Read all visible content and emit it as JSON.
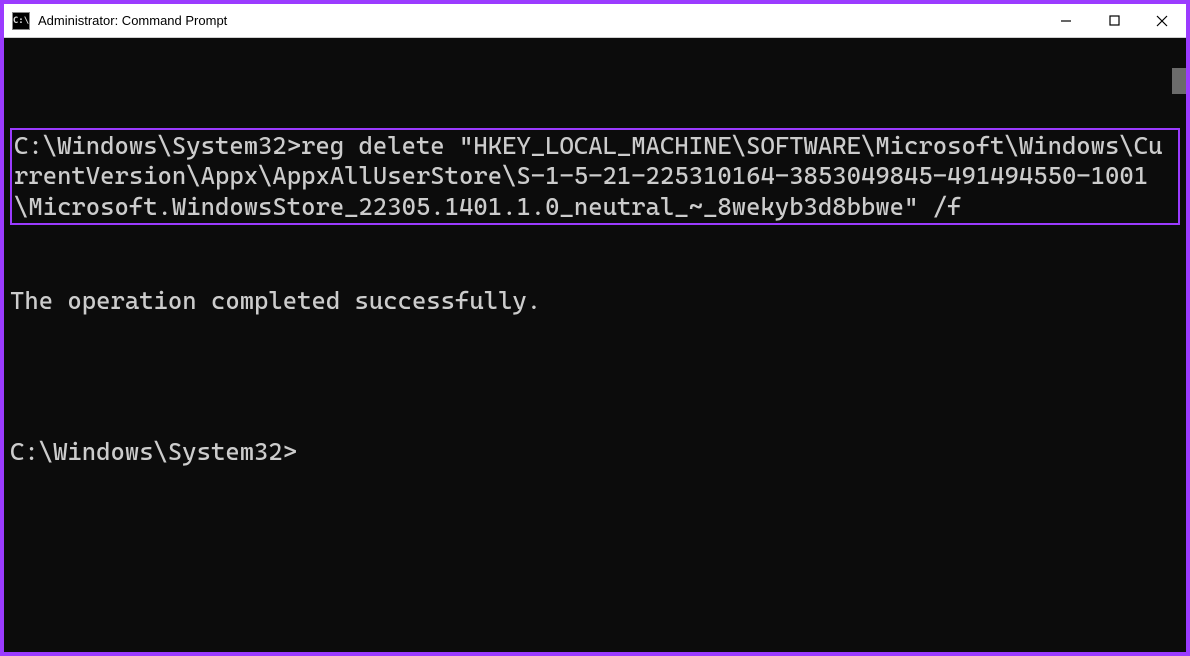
{
  "window": {
    "title": "Administrator: Command Prompt",
    "icon_label": "C:\\"
  },
  "terminal": {
    "prompt1": "C:\\Windows\\System32>",
    "command": "reg delete \"HKEY_LOCAL_MACHINE\\SOFTWARE\\Microsoft\\Windows\\CurrentVersion\\Appx\\AppxAllUserStore\\S-1-5-21-225310164-3853049845-491494550-1001\\Microsoft.WindowsStore_22305.1401.1.0_neutral_~_8wekyb3d8bbwe\" /f",
    "result": "The operation completed successfully.",
    "blank": "",
    "prompt2": "C:\\Windows\\System32>"
  }
}
